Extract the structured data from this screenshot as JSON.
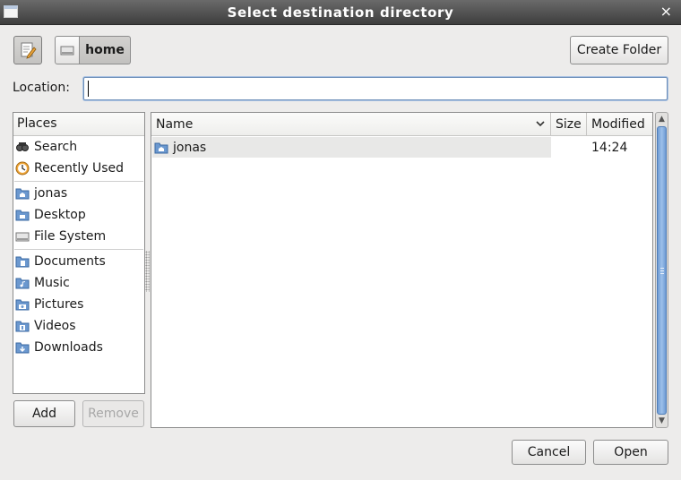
{
  "window": {
    "title": "Select destination directory",
    "close_glyph": "×"
  },
  "toolbar": {
    "path": [
      "home"
    ],
    "create_folder": "Create Folder"
  },
  "location": {
    "label": "Location:",
    "value": ""
  },
  "places": {
    "header": "Places",
    "items": [
      {
        "label": "Search",
        "icon": "search-icon"
      },
      {
        "label": "Recently Used",
        "icon": "recent-icon"
      },
      {
        "label": "jonas",
        "icon": "home-folder-icon"
      },
      {
        "label": "Desktop",
        "icon": "desktop-folder-icon"
      },
      {
        "label": "File System",
        "icon": "drive-icon"
      },
      {
        "label": "Documents",
        "icon": "documents-folder-icon"
      },
      {
        "label": "Music",
        "icon": "music-folder-icon"
      },
      {
        "label": "Pictures",
        "icon": "pictures-folder-icon"
      },
      {
        "label": "Videos",
        "icon": "videos-folder-icon"
      },
      {
        "label": "Downloads",
        "icon": "downloads-folder-icon"
      }
    ],
    "add_label": "Add",
    "remove_label": "Remove"
  },
  "files": {
    "columns": {
      "name": "Name",
      "size": "Size",
      "modified": "Modified"
    },
    "rows": [
      {
        "name": "jonas",
        "size": "",
        "modified": "14:24",
        "icon": "home-folder-icon"
      }
    ]
  },
  "actions": {
    "cancel": "Cancel",
    "open": "Open"
  },
  "colors": {
    "titlebar": "#4a4a4a",
    "selection": "#e8e8e7",
    "scroll_thumb": "#7aa6dc",
    "folder": "#6b98cf"
  }
}
